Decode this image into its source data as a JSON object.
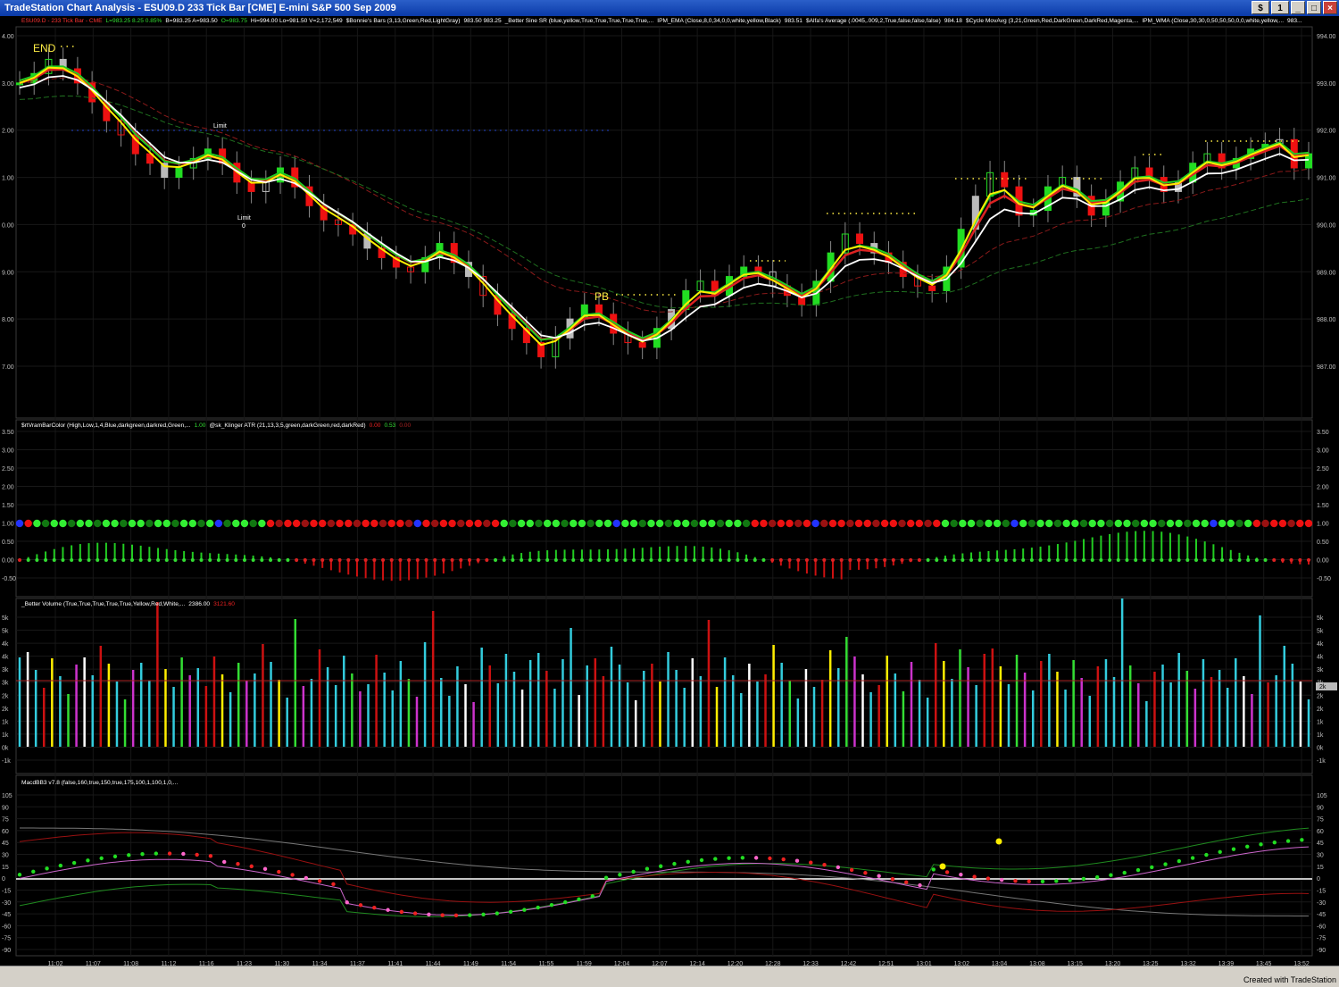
{
  "window": {
    "title": "TradeStation Chart Analysis - ESU09.D 233 Tick Bar [CME] E-mini S&P 500 Sep 2009",
    "btn_s": "$",
    "btn_1": "1",
    "btn_min": "_",
    "btn_max": "□",
    "btn_close": "×"
  },
  "status": {
    "created_with": "Created with TradeStation"
  },
  "colors": {
    "bg": "#000000",
    "grid": "#1c1c1c",
    "axis_text": "#c0c0c0",
    "up": "#22dd22",
    "down": "#ee1111",
    "cyan": "#33ccdd",
    "yellow": "#ffee00"
  },
  "panel1": {
    "info": [
      {
        "text": "ESU09.D - 233 Tick Bar - CME",
        "color": "#ff3333"
      },
      {
        "text": "L=983.25 8.25 0.85%",
        "color": "#33dd33"
      },
      {
        "text": "B=983.25 A=983.50",
        "color": "#ffffff"
      },
      {
        "text": "O=983.75",
        "color": "#33dd33"
      },
      {
        "text": "Hi=994.00 Lo=981.50 V=2,172,549",
        "color": "#ffffff"
      },
      {
        "text": "$Bonnie's Bars (3,13,Green,Red,LightGray)",
        "color": "#ffffff"
      },
      {
        "text": "983.50 983.25",
        "color": "#ffffff"
      },
      {
        "text": "_Better Sine SR (blue,yellow,True,True,True,True,True,...",
        "color": "#ffffff"
      },
      {
        "text": "IPM_EMA (Close,8,0,34,0,0,white,yellow,Black)",
        "color": "#ffffff"
      },
      {
        "text": "983.51",
        "color": "#ffffff"
      },
      {
        "text": "$Alfa's Average (.0045,.009,2,True,false,false,false)",
        "color": "#ffffff"
      },
      {
        "text": "984.18",
        "color": "#ffffff"
      },
      {
        "text": "$Cycle MovAvg (3,21,Green,Red,DarkGreen,DarkRed,Magenta,...",
        "color": "#ffffff"
      },
      {
        "text": "IPM_WMA (Close,30,30,0,50,50,50,0,0,white,yellow,...",
        "color": "#ffffff"
      },
      {
        "text": "983...",
        "color": "#ffffff"
      }
    ],
    "labels": {
      "end": "END",
      "pb": "PB",
      "limit1": "Limit",
      "limit2": "Limit",
      "limit2_qty": "0"
    },
    "left_ticks": [
      "4.00",
      "3.00",
      "2.00",
      "1.00",
      "0.00",
      "9.00",
      "8.00",
      "7.00"
    ],
    "right_ticks": [
      "994.00",
      "993.00",
      "992.00",
      "991.00",
      "990.00",
      "989.00",
      "988.00",
      "987.00"
    ],
    "ylim": [
      986.5,
      994.2
    ]
  },
  "panel2": {
    "info": [
      {
        "text": "$rtVramBarColor (High,Low,1,4,Blue,darkgreen,darkred,Green,...",
        "color": "#ffffff"
      },
      {
        "text": "1.00",
        "color": "#33dd33"
      },
      {
        "text": "@sk_Klinger ATR (21,13,3,5,green,darkGreen,red,darkRed)",
        "color": "#ffffff"
      },
      {
        "text": "0.00",
        "color": "#ee2222"
      },
      {
        "text": "0.53",
        "color": "#33dd33"
      },
      {
        "text": "0.00",
        "color": "#aa2222"
      }
    ],
    "left_ticks": [
      "3.50",
      "3.00",
      "2.50",
      "2.00",
      "1.50",
      "1.00",
      "0.50",
      "0.00",
      "-0.50"
    ],
    "right_ticks": [
      "3.50",
      "3.00",
      "2.50",
      "2.00",
      "1.50",
      "1.00",
      "0.50",
      "0.00",
      "-0.50"
    ]
  },
  "panel3": {
    "info": [
      {
        "text": "_Better Volume (True,True,True,True,True,Yellow,Red,White,...",
        "color": "#ffffff"
      },
      {
        "text": "2386.00",
        "color": "#ffffff"
      },
      {
        "text": "3121.60",
        "color": "#ee2222"
      }
    ],
    "left_ticks": [
      "5k",
      "5k",
      "4k",
      "4k",
      "3k",
      "3k",
      "2k",
      "2k",
      "1k",
      "1k",
      "0k",
      "-1k"
    ],
    "right_ticks": [
      "5k",
      "5k",
      "4k",
      "4k",
      "3k",
      "3k",
      "2k",
      "2k",
      "1k",
      "1k",
      "0k",
      "-1k"
    ],
    "right_marker": "2k"
  },
  "panel4": {
    "info": [
      {
        "text": "MacdBB3 v7.8 (false,160,true,150,true,175,100,1,100,1,0,...",
        "color": "#ffffff"
      }
    ],
    "left_ticks": [
      "105",
      "90",
      "75",
      "60",
      "45",
      "30",
      "15",
      "0",
      "-15",
      "-30",
      "-45",
      "-60",
      "-75",
      "-90"
    ],
    "right_ticks": [
      "105",
      "90",
      "75",
      "60",
      "45",
      "30",
      "15",
      "0",
      "-15",
      "-30",
      "-45",
      "-60",
      "-75",
      "-90"
    ]
  },
  "time_axis": [
    "11:02",
    "11:07",
    "11:08",
    "11:12",
    "11:16",
    "11:23",
    "11:30",
    "11:34",
    "11:37",
    "11:41",
    "11:44",
    "11:49",
    "11:54",
    "11:55",
    "11:59",
    "12:04",
    "12:07",
    "12:14",
    "12:20",
    "12:28",
    "12:33",
    "12:42",
    "12:51",
    "13:01",
    "13:02",
    "13:04",
    "13:08",
    "13:15",
    "13:20",
    "13:25",
    "13:32",
    "13:39",
    "13:45",
    "13:52"
  ]
}
